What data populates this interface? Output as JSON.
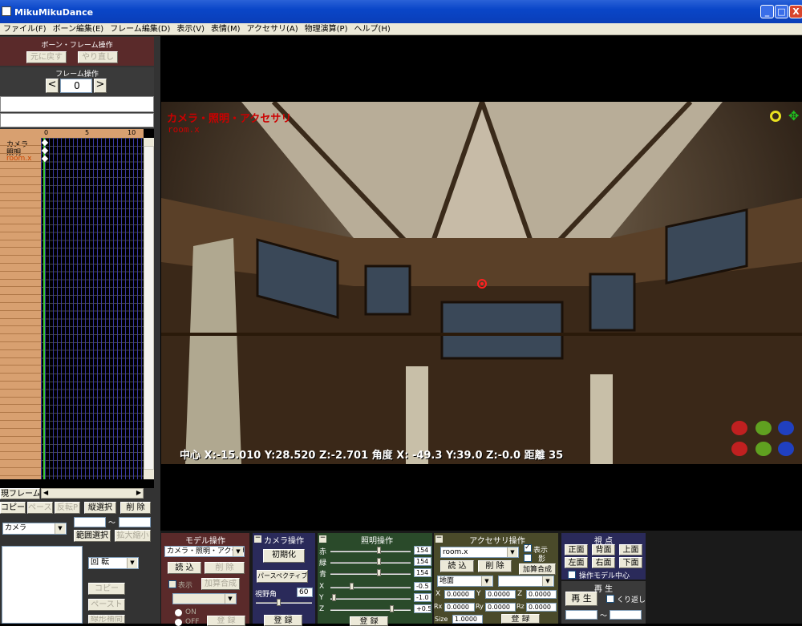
{
  "window": {
    "title": "MikuMikuDance",
    "min": "_",
    "max": "□",
    "close": "X"
  },
  "menu": [
    "ファイル(F)",
    "ボーン編集(E)",
    "フレーム編集(D)",
    "表示(V)",
    "表情(M)",
    "アクセサリ(A)",
    "物理演算(P)",
    "ヘルプ(H)"
  ],
  "bone_panel": {
    "header": "ボーン・フレーム操作",
    "undo": "元に戻す",
    "redo": "やり直し"
  },
  "frame_panel": {
    "header": "フレーム操作",
    "prev": "<",
    "frame": "0",
    "next": ">"
  },
  "timeline": {
    "ticks": [
      "0",
      "5",
      "10"
    ],
    "tracks": [
      "カメラ",
      "照明",
      "room.x"
    ],
    "current_frame": "現フレーム"
  },
  "left_tools": {
    "copy": "コピー",
    "paste": "ペースト",
    "reverse": "反転P",
    "vertical_select": "縦選択",
    "delete": "削 除",
    "range_select": "範囲選択",
    "scale": "拡大縮小",
    "tilde": "～",
    "mode": "カメラ",
    "rotate": "回 転",
    "copy2": "コピー",
    "paste2": "ペースト",
    "interp": "線形補間"
  },
  "viewport": {
    "model_label": "カメラ・照明・アクセサリ",
    "accessory": "room.x",
    "status": "中心 X:-15.010 Y:28.520 Z:-2.701  角度 X: -49.3 Y:39.0 Z:-0.0  距離 35"
  },
  "model_panel": {
    "header": "モデル操作",
    "model": "カメラ・照明・アクセサリ",
    "load": "読 込",
    "delete": "削 除",
    "show": "表示",
    "add_blend": "加算合成",
    "on": "ON",
    "off": "OFF",
    "register": "登 録"
  },
  "camera_panel": {
    "header": "カメラ操作",
    "init": "初期化",
    "perspective": "パースペクティブ",
    "fov_label": "視野角",
    "fov": "60",
    "register": "登 録"
  },
  "light_panel": {
    "header": "照明操作",
    "r_label": "赤",
    "g_label": "緑",
    "b_label": "青",
    "r": "154",
    "g": "154",
    "b": "154",
    "x_label": "X",
    "y_label": "Y",
    "z_label": "Z",
    "x": "-0.5",
    "y": "-1.0",
    "z": "+0.5",
    "register": "登 録"
  },
  "acc_panel": {
    "header": "アクセサリ操作",
    "accessory": "room.x",
    "show": "表示",
    "shadow": "影",
    "load": "読 込",
    "delete": "削 除",
    "add_blend": "加算合成",
    "parent": "地面",
    "x_label": "X",
    "y_label": "Y",
    "z_label": "Z",
    "x": "0.0000",
    "y": "0.0000",
    "z": "0.0000",
    "rx_label": "Rx",
    "ry_label": "Ry",
    "rz_label": "Rz",
    "rx": "0.0000",
    "ry": "0.0000",
    "rz": "0.0000",
    "size_label": "Size",
    "size": "1.0000",
    "register": "登 録"
  },
  "view_panel": {
    "header": "視 点",
    "front": "正面",
    "back": "背面",
    "top": "上面",
    "left": "左面",
    "right": "右面",
    "bottom": "下面",
    "center_model": "操作モデル中心"
  },
  "play_panel": {
    "header": "再 生",
    "play": "再 生",
    "loop": "くり返し",
    "tilde": "～"
  },
  "colors": {
    "panel_red": "#5a2a2a",
    "panel_blue": "#2a2a5a",
    "panel_green": "#2a4a2a",
    "panel_olive": "#4a4a2a",
    "label_red": "#cc0000"
  }
}
